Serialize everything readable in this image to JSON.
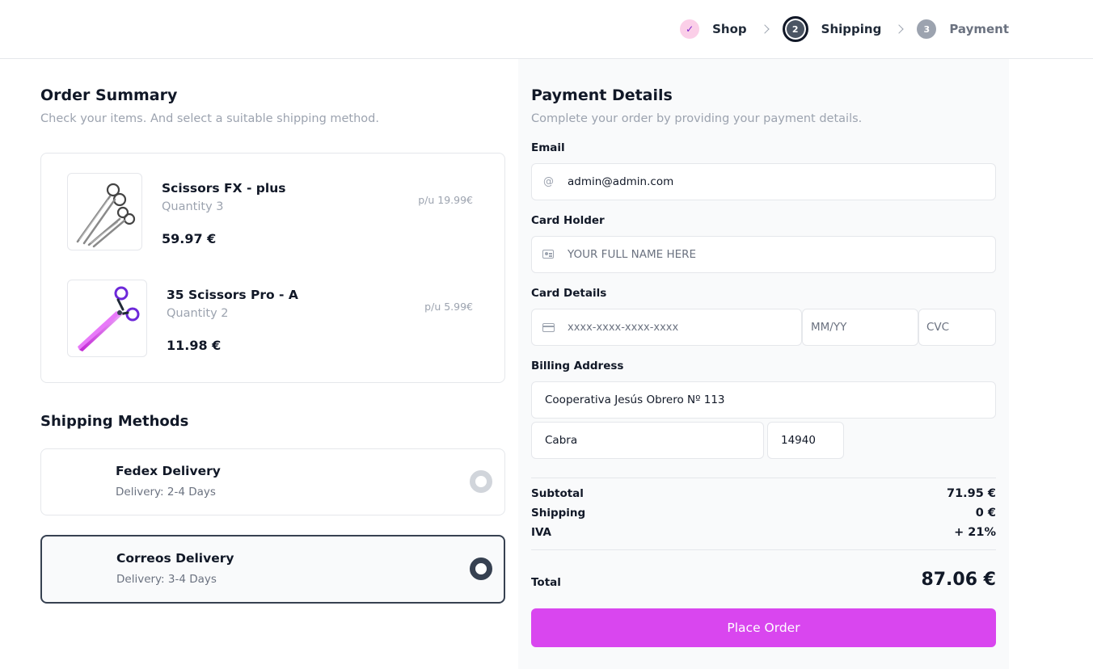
{
  "steps": [
    {
      "number": "✓",
      "label": "Shop",
      "state": "done"
    },
    {
      "number": "2",
      "label": "Shipping",
      "state": "active"
    },
    {
      "number": "3",
      "label": "Payment",
      "state": "todo"
    }
  ],
  "order_summary": {
    "title": "Order Summary",
    "subtitle": "Check your items. And select a suitable shipping method.",
    "items": [
      {
        "name": "Scissors FX - plus",
        "quantity": "Quantity 3",
        "unit_price": "p/u 19.99€",
        "total": "59.97 €"
      },
      {
        "name": "35 Scissors Pro - A",
        "quantity": "Quantity 2",
        "unit_price": "p/u 5.99€",
        "total": "11.98 €"
      }
    ]
  },
  "shipping": {
    "title": "Shipping Methods",
    "methods": [
      {
        "name": "Fedex Delivery",
        "eta": "Delivery: 2-4 Days",
        "selected": false
      },
      {
        "name": "Correos Delivery",
        "eta": "Delivery: 3-4 Days",
        "selected": true
      }
    ]
  },
  "payment": {
    "title": "Payment Details",
    "subtitle": "Complete your order by providing your payment details.",
    "email_label": "Email",
    "email_value": "admin@admin.com",
    "card_holder_label": "Card Holder",
    "card_holder_placeholder": "YOUR FULL NAME HERE",
    "card_details_label": "Card Details",
    "card_number_placeholder": "xxxx-xxxx-xxxx-xxxx",
    "expiry_placeholder": "MM/YY",
    "cvc_placeholder": "CVC",
    "billing_label": "Billing Address",
    "address_value": "Cooperativa Jesús Obrero Nº 113",
    "city_value": "Cabra",
    "zip_value": "14940"
  },
  "totals": {
    "subtotal_label": "Subtotal",
    "subtotal_value": "71.95 €",
    "shipping_label": "Shipping",
    "shipping_value": "0 €",
    "tax_label": "IVA",
    "tax_value": "+ 21%",
    "total_label": "Total",
    "total_value": "87.06 €"
  },
  "place_order_label": "Place Order",
  "colors": {
    "accent": "#d946ef",
    "step_done": "#fbcfe8",
    "step_active": "#4b5563",
    "selected_border": "#374151"
  }
}
